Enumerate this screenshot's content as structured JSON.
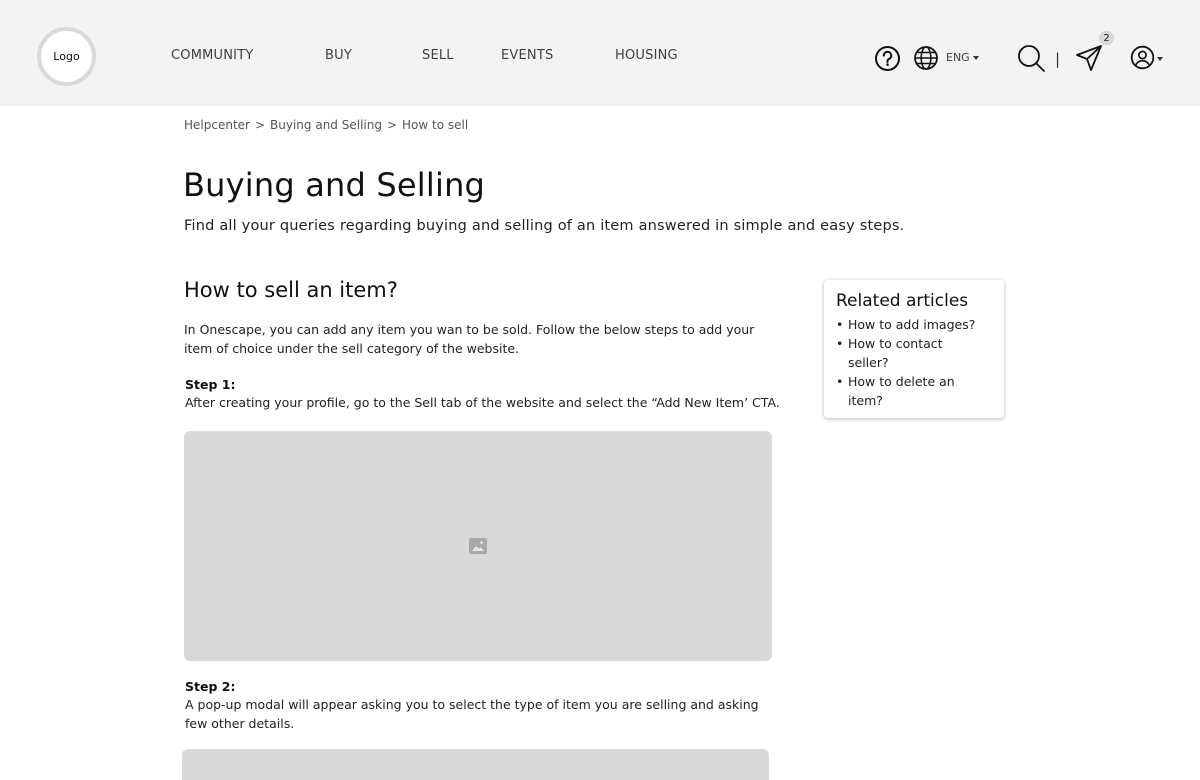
{
  "header": {
    "logo": "Logo",
    "nav": [
      "COMMUNITY",
      "BUY",
      "SELL",
      "EVENTS",
      "HOUSING"
    ],
    "language": "ENG",
    "separator": "|",
    "notification_count": "2"
  },
  "breadcrumb": [
    "Helpcenter",
    ">",
    "Buying and Selling",
    ">",
    "How to sell"
  ],
  "page": {
    "title": "Buying and Selling",
    "subtitle": "Find all your queries regarding buying and selling of an item answered in simple and easy steps."
  },
  "article": {
    "title": "How to sell an item?",
    "intro": "In Onescape, you can add any item you wan to be sold. Follow the below steps to add your item of choice under the sell category of the website.",
    "steps": [
      {
        "label": "Step 1:",
        "text": "After creating your profile, go to the Sell tab of the website and select the “Add New Item’ CTA."
      },
      {
        "label": "Step 2:",
        "text": "A pop-up modal will appear asking you to select the type of item you are selling and asking few other details."
      }
    ]
  },
  "related": {
    "title": "Related articles",
    "items": [
      "How to add images?",
      "How to contact seller?",
      "How to delete an item?"
    ]
  }
}
